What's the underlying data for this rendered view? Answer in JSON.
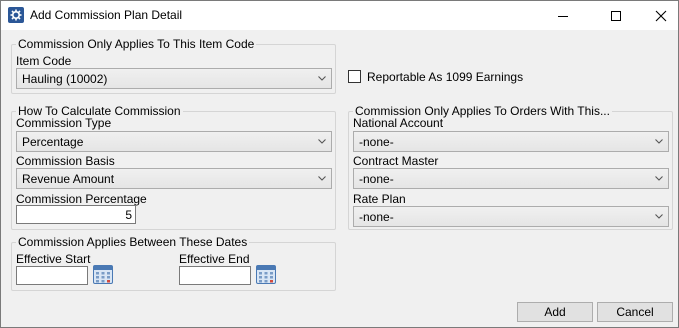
{
  "window": {
    "title": "Add Commission Plan Detail",
    "icon": "gear-app-icon",
    "controls": [
      "minimize-icon",
      "maximize-icon",
      "close-icon"
    ]
  },
  "item_code_group": {
    "legend": "Commission Only Applies To This Item Code",
    "item_code_label": "Item Code",
    "item_code_value": "Hauling (10002)"
  },
  "reportable": {
    "label": "Reportable As 1099 Earnings",
    "checked": false
  },
  "calc_group": {
    "legend": "How To Calculate Commission",
    "type_label": "Commission Type",
    "type_value": "Percentage",
    "basis_label": "Commission Basis",
    "basis_value": "Revenue Amount",
    "percentage_label": "Commission Percentage",
    "percentage_value": "5"
  },
  "orders_group": {
    "legend": "Commission Only Applies To Orders With This...",
    "national_account_label": "National Account",
    "national_account_value": "-none-",
    "contract_master_label": "Contract Master",
    "contract_master_value": "-none-",
    "rate_plan_label": "Rate Plan",
    "rate_plan_value": "-none-"
  },
  "dates_group": {
    "legend": "Commission Applies Between These Dates",
    "start_label": "Effective Start",
    "start_value": "",
    "end_label": "Effective End",
    "end_value": ""
  },
  "buttons": {
    "add": "Add",
    "cancel": "Cancel"
  },
  "colors": {
    "window_bg": "#f0f0f0",
    "titlebar_bg": "#ffffff",
    "combo_bg": "#e5e5e5",
    "button_bg": "#e1e1e1",
    "icon_blue": "#2b5797"
  }
}
